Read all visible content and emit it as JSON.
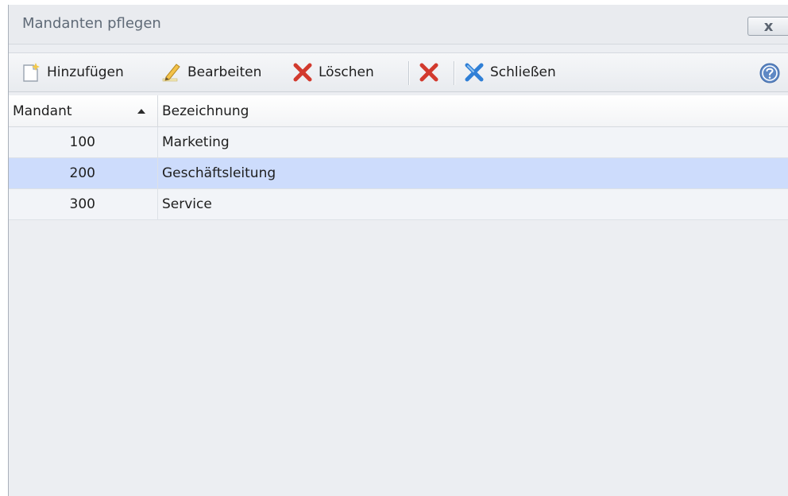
{
  "window": {
    "title": "Mandanten pflegen",
    "close_label": "x"
  },
  "toolbar": {
    "add_label": "Hinzufügen",
    "edit_label": "Bearbeiten",
    "delete_label": "Löschen",
    "close_label": "Schließen"
  },
  "table": {
    "columns": [
      "Mandant",
      "Bezeichnung"
    ],
    "sort_column": "Mandant",
    "sort_direction": "ascending",
    "selected_row": 1,
    "rows": [
      {
        "mandant": "100",
        "bezeichnung": "Marketing"
      },
      {
        "mandant": "200",
        "bezeichnung": "Geschäftsleitung"
      },
      {
        "mandant": "300",
        "bezeichnung": "Service"
      }
    ]
  },
  "colors": {
    "selection": "#cddcfc",
    "delete_red": "#d23a2e",
    "close_blue": "#2f7fd6"
  }
}
